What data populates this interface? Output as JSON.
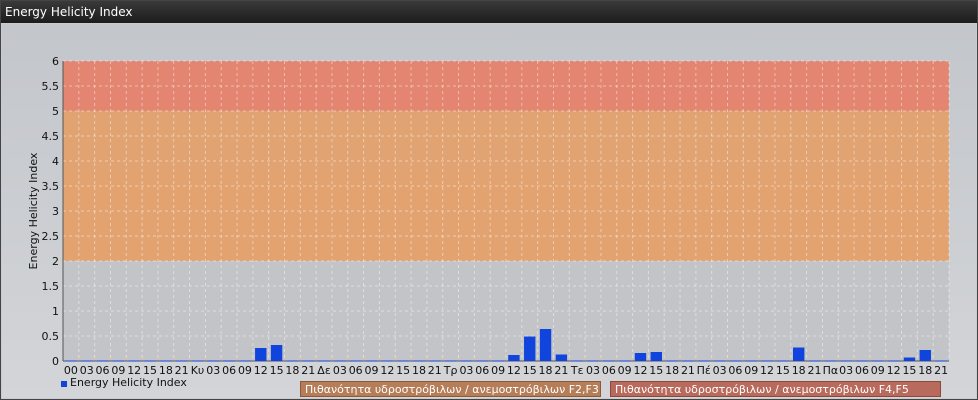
{
  "window": {
    "title": "Energy Helicity Index"
  },
  "legend": {
    "series_label": "Energy Helicity Index",
    "band_f2f3": "Πιθανότητα υδροστρόβιλων / ανεμοστρόβιλων F2,F3",
    "band_f4f5": "Πιθανότητα υδροστρόβιλων / ανεμοστρόβιλων F4,F5"
  },
  "colors": {
    "bar": "#1144dd",
    "band_low": "#c2c4c8",
    "band_f2f3": "#e3a06b",
    "band_f4f5": "#e5826a",
    "legend_f2f3": "#b57d58",
    "legend_f4f5": "#b86a5c"
  },
  "chart_data": {
    "type": "bar",
    "ylabel": "Energy Helicity Index",
    "ylim": [
      0,
      6
    ],
    "yticks": [
      "0",
      "0.5",
      "1",
      "1.5",
      "2",
      "2.5",
      "3",
      "3.5",
      "4",
      "4.5",
      "5",
      "5.5",
      "6"
    ],
    "grid": true,
    "legend_position": "bottom",
    "bands": [
      {
        "name": "Πιθανότητα υδροστρόβιλων / ανεμοστρόβιλων F2,F3",
        "from": 2,
        "to": 5
      },
      {
        "name": "Πιθανότητα υδροστρόβιλων / ανεμοστρόβιλων F4,F5",
        "from": 5,
        "to": 6
      }
    ],
    "categories": [
      "00",
      "03",
      "06",
      "09",
      "12",
      "15",
      "18",
      "21",
      "Κυ",
      "03",
      "06",
      "09",
      "12",
      "15",
      "18",
      "21",
      "Δε",
      "03",
      "06",
      "09",
      "12",
      "15",
      "18",
      "21",
      "Τρ",
      "03",
      "06",
      "09",
      "12",
      "15",
      "18",
      "21",
      "Τε",
      "03",
      "06",
      "09",
      "12",
      "15",
      "18",
      "21",
      "Πέ",
      "03",
      "06",
      "09",
      "12",
      "15",
      "18",
      "21",
      "Πα",
      "03",
      "06",
      "09",
      "12",
      "15",
      "18",
      "21"
    ],
    "series": [
      {
        "name": "Energy Helicity Index",
        "values": [
          0.01,
          0.01,
          0.01,
          0.01,
          0.01,
          0.01,
          0.01,
          0.01,
          0.01,
          0.01,
          0.01,
          0.01,
          0.26,
          0.32,
          0.01,
          0.01,
          0.01,
          0.01,
          0.01,
          0.01,
          0.01,
          0.01,
          0.01,
          0.01,
          0.01,
          0.01,
          0.01,
          0.01,
          0.12,
          0.49,
          0.64,
          0.13,
          0.01,
          0.01,
          0.01,
          0.01,
          0.16,
          0.18,
          0.01,
          0.01,
          0.01,
          0.01,
          0.01,
          0.01,
          0.01,
          0.01,
          0.27,
          0.01,
          0.01,
          0.01,
          0.01,
          0.01,
          0.01,
          0.07,
          0.22,
          0.01
        ]
      }
    ]
  }
}
